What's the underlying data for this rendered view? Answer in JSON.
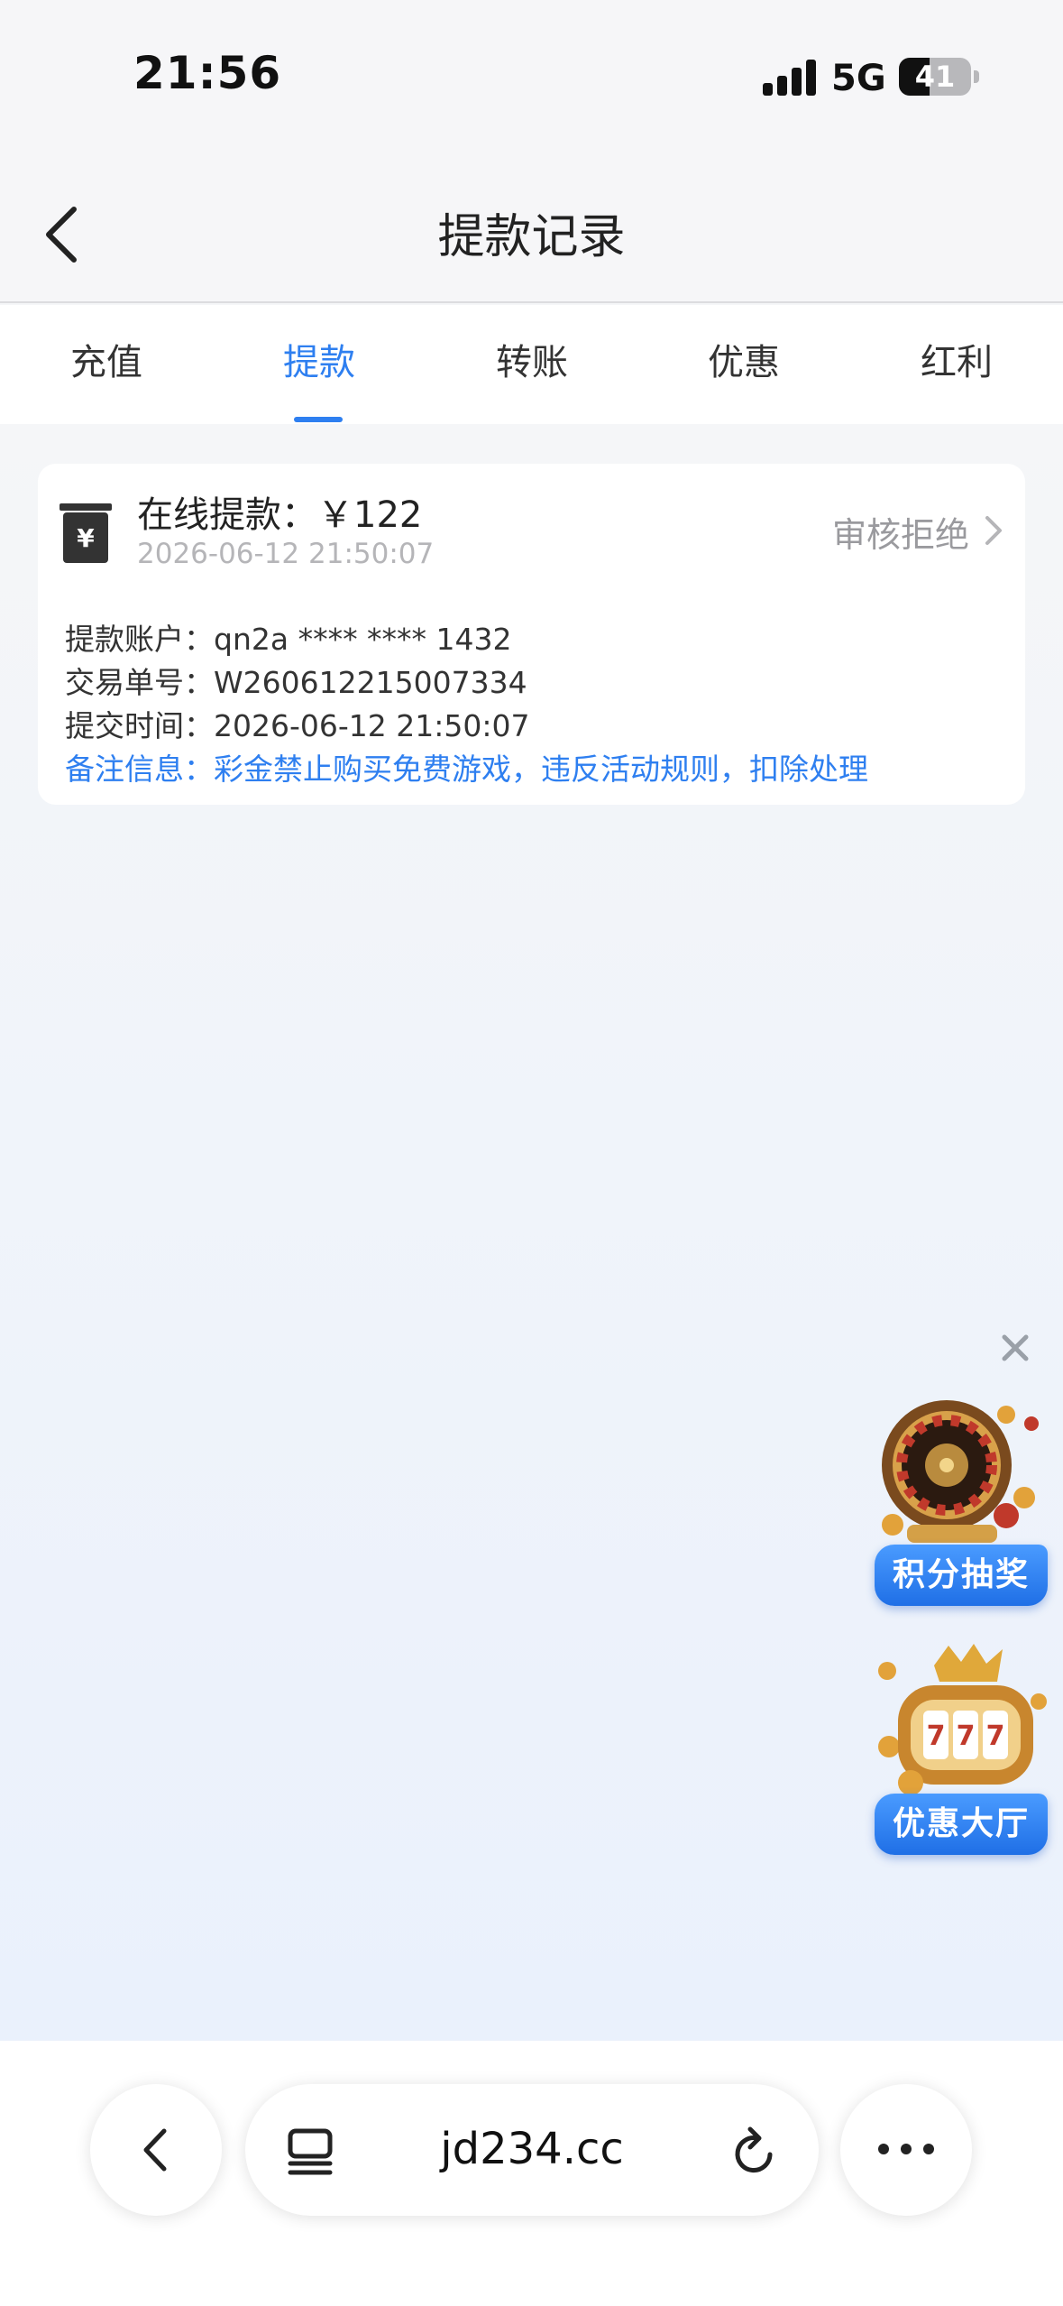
{
  "status_bar": {
    "time": "21:56",
    "network": "5G",
    "battery": "41"
  },
  "header": {
    "title": "提款记录"
  },
  "tabs": [
    {
      "label": "充值",
      "active": false
    },
    {
      "label": "提款",
      "active": true
    },
    {
      "label": "转账",
      "active": false
    },
    {
      "label": "优惠",
      "active": false
    },
    {
      "label": "红利",
      "active": false
    }
  ],
  "record": {
    "title": "在线提款：￥122",
    "date": "2026-06-12 21:50:07",
    "status": "审核拒绝",
    "details": [
      {
        "label": "提款账户：",
        "value": "qn2a **** **** 1432"
      },
      {
        "label": "交易单号：",
        "value": "W260612215007334"
      },
      {
        "label": "提交时间：",
        "value": "2026-06-12 21:50:07"
      }
    ],
    "note": {
      "label": "备注信息：",
      "value": "彩金禁止购买免费游戏，违反活动规则，扣除处理"
    }
  },
  "promos": [
    {
      "label": "积分抽奖",
      "icon": "roulette-icon"
    },
    {
      "label": "优惠大厅",
      "icon": "slot-machine-icon"
    }
  ],
  "browser": {
    "url": "jd234.cc"
  },
  "colors": {
    "accent": "#2e7ff0",
    "status_rejected": "#9a9a9e"
  }
}
